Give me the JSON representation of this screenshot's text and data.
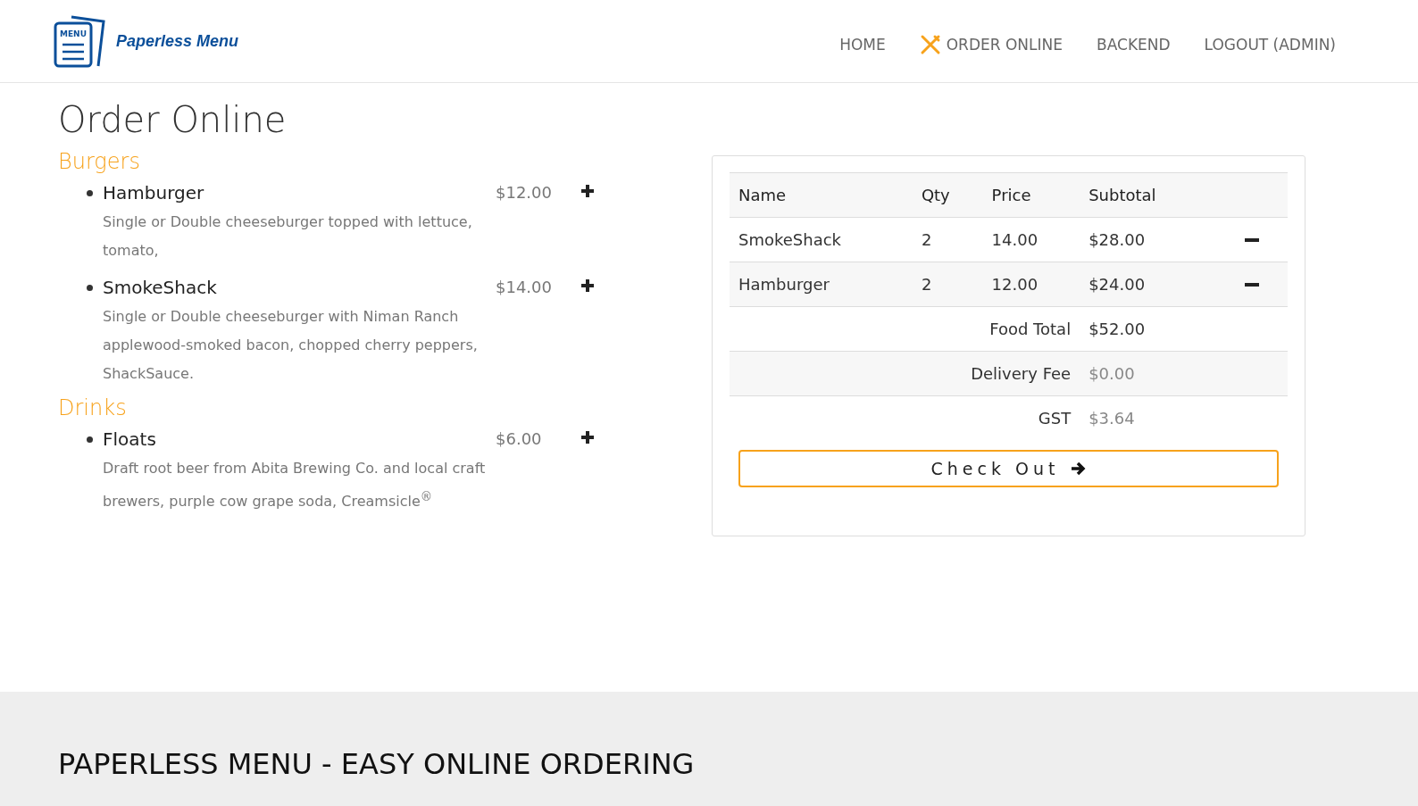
{
  "brand": {
    "logo_text": "MENU",
    "name": "Paperless Menu"
  },
  "nav": [
    {
      "label": "HOME",
      "selected": false
    },
    {
      "label": "ORDER ONLINE",
      "selected": true
    },
    {
      "label": "BACKEND",
      "selected": false
    },
    {
      "label": "LOGOUT (ADMIN)",
      "selected": false
    }
  ],
  "page_title": "Order Online",
  "categories": [
    {
      "name": "Burgers",
      "items": [
        {
          "name": "Hamburger",
          "price": "$12.00",
          "description": "Single or Double cheeseburger topped with lettuce, tomato,"
        },
        {
          "name": "SmokeShack",
          "price": "$14.00",
          "description": "Single or Double cheeseburger with Niman Ranch applewood-smoked bacon, chopped cherry peppers, ShackSauce."
        }
      ]
    },
    {
      "name": "Drinks",
      "items": [
        {
          "name": "Floats",
          "price": "$6.00",
          "description": "Draft root beer from Abita Brewing Co. and local craft brewers, purple cow grape soda, Creamsicle$^{®}$"
        }
      ]
    }
  ],
  "cart": {
    "columns": [
      "Name",
      "Qty",
      "Price",
      "Subtotal"
    ],
    "rows": [
      {
        "name": "SmokeShack",
        "qty": "2",
        "price": "14.00",
        "subtotal": "$28.00"
      },
      {
        "name": "Hamburger",
        "qty": "2",
        "price": "12.00",
        "subtotal": "$24.00"
      }
    ],
    "totals": [
      {
        "label": "Food Total",
        "value": "$52.00"
      },
      {
        "label": "Delivery Fee",
        "value": "$0.00"
      },
      {
        "label": "GST",
        "value": "$3.64"
      }
    ],
    "checkout_button": "Check Out"
  },
  "footer": {
    "heading": "PAPERLESS MENU - EASY ONLINE ORDERING"
  }
}
